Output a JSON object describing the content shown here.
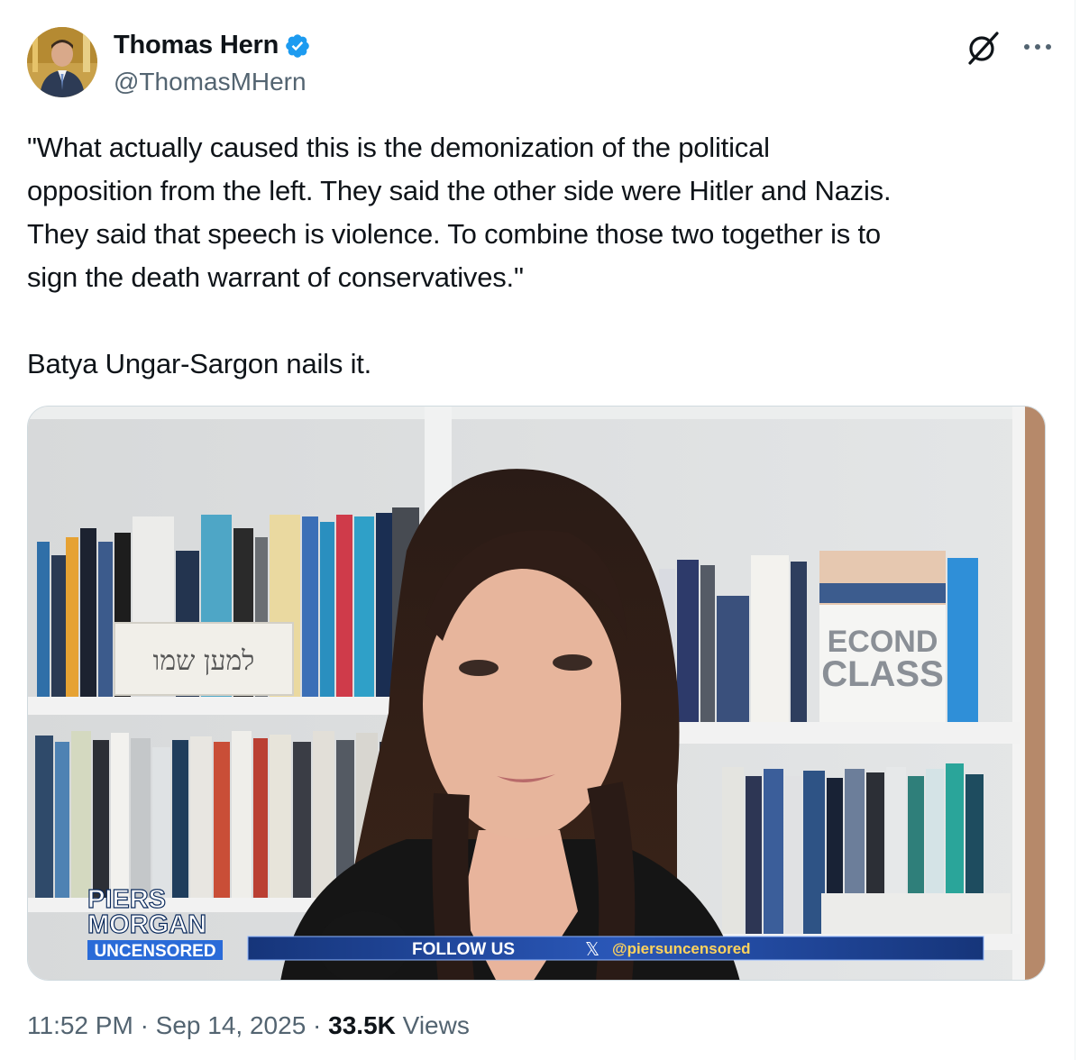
{
  "author": {
    "display_name": "Thomas Hern",
    "handle": "@ThomasMHern",
    "verified": true,
    "verified_color": "#1d9bf0"
  },
  "actions": {
    "grok_icon": "grok-icon",
    "more_icon": "more-horizontal-icon"
  },
  "tweet": {
    "lines": [
      "\"What actually caused this is the demonization of the political",
      "opposition from the left. They said the other side were Hitler and Nazis.",
      "They said that speech is violence. To combine those two together is to",
      "sign the death warrant of conservatives.\"",
      "Batya Ungar-Sargon nails it."
    ]
  },
  "media": {
    "sign_text": "למען שמו",
    "book_title_line1": "ECOND",
    "book_title_line2": "CLASS",
    "show_logo_line1": "PIERS",
    "show_logo_line2": "MORGAN",
    "show_logo_line3": "UNCENSORED",
    "follow_text": "FOLLOW US",
    "x_glyph": "𝕏",
    "follow_handle": "@piersuncensored",
    "ticker_color": "#1b3f8f"
  },
  "meta": {
    "time": "11:52 PM",
    "separator": "·",
    "date": "Sep 14, 2025",
    "views_count": "33.5K",
    "views_label": "Views"
  }
}
